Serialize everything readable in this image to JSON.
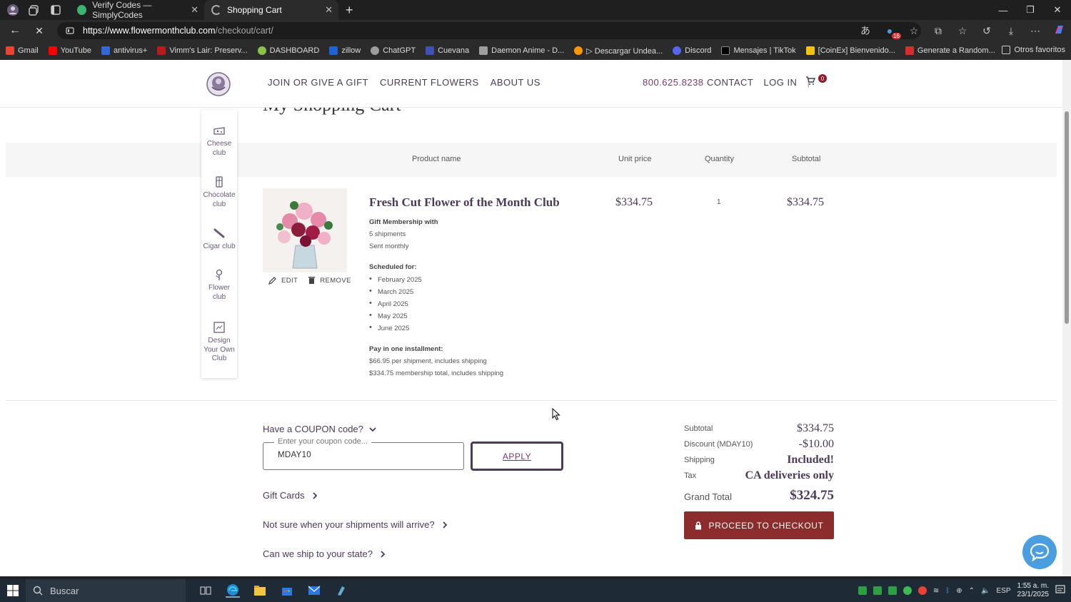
{
  "browser": {
    "tabs": [
      {
        "title": "Verify Codes — SimplyCodes",
        "active": false
      },
      {
        "title": "Shopping Cart",
        "active": true
      }
    ],
    "url_host": "https://www.flowermonthclub.com",
    "url_path": "/checkout/cart/",
    "bookmarks": [
      "Gmail",
      "YouTube",
      "antivirus+",
      "Vimm's Lair: Preserv...",
      "DASHBOARD",
      "zillow",
      "ChatGPT",
      "Cuevana",
      "Daemon Anime - D...",
      "▷ Descargar Undea...",
      "Discord",
      "Mensajes | TikTok",
      "[CoinEx] Bienvenido...",
      "Generate a Random..."
    ],
    "bookmark_colors": [
      "#ea4335",
      "#ff0000",
      "#3367d6",
      "#b71c1c",
      "#8bc34a",
      "#1e63d6",
      "#9e9e9e",
      "#3f51b5",
      "#9e9e9e",
      "#ff9800",
      "#5865f2",
      "#000000",
      "#f4c20d",
      "#d32f2f"
    ],
    "other_bookmarks": "Otros favoritos",
    "extension_badge": "16"
  },
  "site": {
    "nav": [
      "JOIN OR GIVE A GIFT",
      "CURRENT FLOWERS",
      "ABOUT US"
    ],
    "phone": "800.625.8238",
    "contact": "CONTACT",
    "login": "LOG IN",
    "separator": "|",
    "cart_count": "0"
  },
  "page": {
    "title": "My Shopping Cart",
    "columns": {
      "product": "Product name",
      "unit_price": "Unit price",
      "quantity": "Quantity",
      "subtotal": "Subtotal"
    }
  },
  "sidebar": [
    {
      "label1": "Cheese",
      "label2": "club",
      "label3": "",
      "icon": "cheese-icon"
    },
    {
      "label1": "Chocolate",
      "label2": "club",
      "label3": "",
      "icon": "chocolate-icon"
    },
    {
      "label1": "Cigar club",
      "label2": "",
      "label3": "",
      "icon": "cigar-icon"
    },
    {
      "label1": "Flower",
      "label2": "club",
      "label3": "",
      "icon": "flower-icon"
    },
    {
      "label1": "Design",
      "label2": "Your Own",
      "label3": "Club",
      "icon": "design-icon"
    }
  ],
  "item": {
    "name": "Fresh Cut Flower of the Month Club",
    "unit_price": "$334.75",
    "quantity": "1",
    "subtotal": "$334.75",
    "edit": "EDIT",
    "remove": "REMOVE",
    "gift_label": "Gift Membership with",
    "shipments": "5 shipments",
    "frequency": "Sent monthly",
    "scheduled_label": "Scheduled for:",
    "schedule": [
      "February 2025",
      "March 2025",
      "April 2025",
      "May 2025",
      "June 2025"
    ],
    "pay_label": "Pay in one installment:",
    "per_shipment": "$66.95 per shipment, includes shipping",
    "membership_total": "$334.75 membership total, includes shipping"
  },
  "coupon": {
    "toggle": "Have a COUPON code?",
    "legend": "Enter your coupon code...",
    "value": "MDAY10",
    "apply": "APPLY"
  },
  "links": {
    "gift_cards": "Gift Cards",
    "shipments": "Not sure when your shipments will arrive?",
    "ship_state": "Can we ship to your state?"
  },
  "totals": {
    "subtotal_label": "Subtotal",
    "subtotal": "$334.75",
    "discount_label": "Discount (MDAY10)",
    "discount": "-$10.00",
    "shipping_label": "Shipping",
    "shipping": "Included!",
    "tax_label": "Tax",
    "tax": "CA deliveries only",
    "grand_label": "Grand Total",
    "grand": "$324.75",
    "checkout": "PROCEED TO CHECKOUT"
  },
  "taskbar": {
    "search": "Buscar",
    "lang": "ESP",
    "time": "1:55 a. m.",
    "date": "23/1/2025"
  },
  "colors": {
    "brand_purple": "#4b3a5a",
    "brand_plum": "#7b3a6a",
    "checkout_red": "#8c2c2c",
    "chat_blue": "#4a9ee0"
  }
}
